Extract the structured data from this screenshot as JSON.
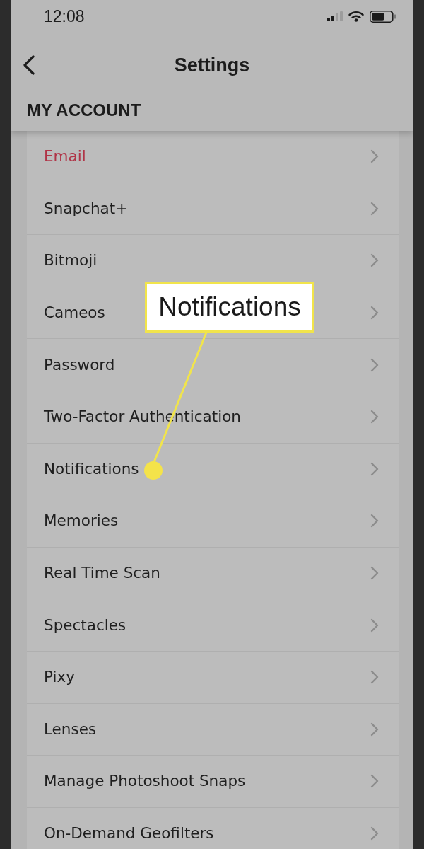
{
  "status_bar": {
    "time": "12:08"
  },
  "header": {
    "title": "Settings"
  },
  "section": {
    "title": "MY ACCOUNT"
  },
  "items": [
    {
      "label": "Email",
      "alert": true
    },
    {
      "label": "Snapchat+",
      "alert": false
    },
    {
      "label": "Bitmoji",
      "alert": false
    },
    {
      "label": "Cameos",
      "alert": false
    },
    {
      "label": "Password",
      "alert": false
    },
    {
      "label": "Two-Factor Authentication",
      "alert": false
    },
    {
      "label": "Notifications",
      "alert": false
    },
    {
      "label": "Memories",
      "alert": false
    },
    {
      "label": "Real Time Scan",
      "alert": false
    },
    {
      "label": "Spectacles",
      "alert": false
    },
    {
      "label": "Pixy",
      "alert": false
    },
    {
      "label": "Lenses",
      "alert": false
    },
    {
      "label": "Manage Photoshoot Snaps",
      "alert": false
    },
    {
      "label": "On-Demand Geofilters",
      "alert": false
    }
  ],
  "callout": {
    "text": "Notifications"
  }
}
